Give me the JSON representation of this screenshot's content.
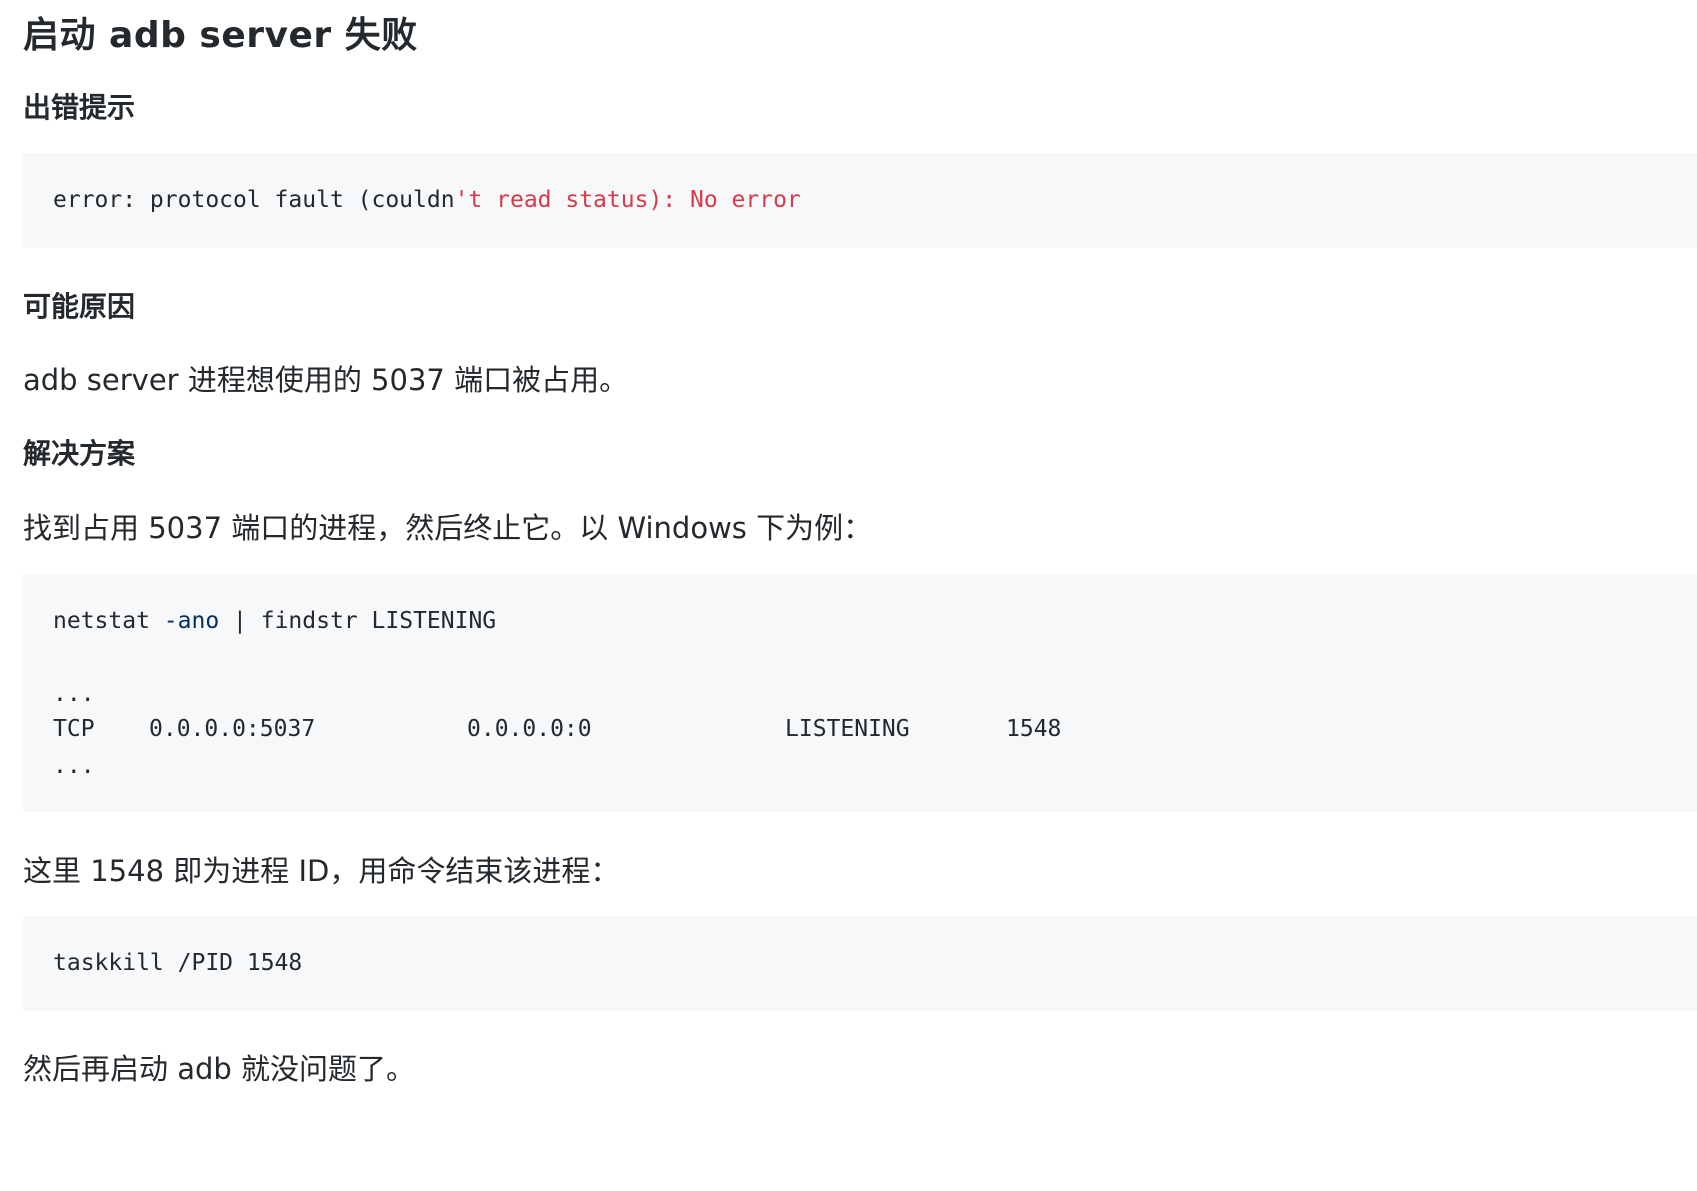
{
  "title": "启动 adb server 失败",
  "sections": {
    "error": {
      "heading": "出错提示",
      "code": {
        "plain": "error: protocol fault (couldn",
        "string": "'t read status): No error"
      }
    },
    "cause": {
      "heading": "可能原因",
      "text": "adb server 进程想使用的 5037 端口被占用。"
    },
    "solution": {
      "heading": "解决方案",
      "intro": "找到占用 5037 端口的进程，然后终止它。以 Windows 下为例：",
      "netstat": {
        "cmd": "netstat",
        "opt": "-ano",
        "rest": "| findstr LISTENING",
        "ellipsis_top": "...",
        "row": {
          "proto": "TCP",
          "local": "0.0.0.0:5037",
          "foreign": "0.0.0.0:0",
          "state": "LISTENING",
          "pid": "1548"
        },
        "ellipsis_bottom": "..."
      },
      "explain": "这里 1548 即为进程 ID，用命令结束该进程：",
      "taskkill": "taskkill /PID 1548",
      "outro": "然后再启动 adb 就没问题了。"
    }
  }
}
